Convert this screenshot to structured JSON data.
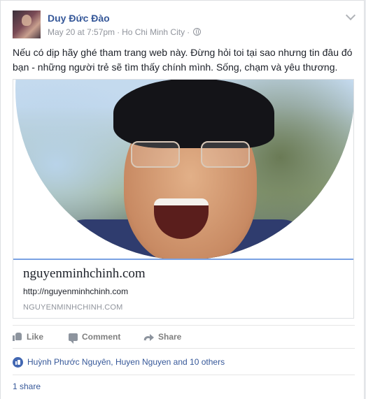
{
  "post": {
    "author": "Duy Đức Đào",
    "date": "May 20 at 7:57pm",
    "separator": "·",
    "location": "Ho Chi Minh City",
    "separator2": "·",
    "privacy_icon": "globe-icon",
    "menu_icon": "chevron-down-icon",
    "text": "Nếu có dịp hãy ghé tham trang web này. Đừng hỏi toi tại sao nhưng tin đâu đó bạn - những người trẻ sẽ tìm thấy chính mình. Sống, chạm và yêu thương."
  },
  "link_preview": {
    "title": "nguyenminhchinh.com",
    "url": "http://nguyenminhchinh.com",
    "domain": "NGUYENMINHCHINH.COM",
    "accent_color": "#7aa2e3"
  },
  "actions": {
    "like": "Like",
    "comment": "Comment",
    "share": "Share"
  },
  "reactions": {
    "text": "Huỳnh Phước Nguyên, Huyen Nguyen and 10 others"
  },
  "shares": {
    "text": "1 share"
  },
  "colors": {
    "link_blue": "#365899",
    "meta_gray": "#90949c",
    "like_blue": "#4267b2"
  }
}
